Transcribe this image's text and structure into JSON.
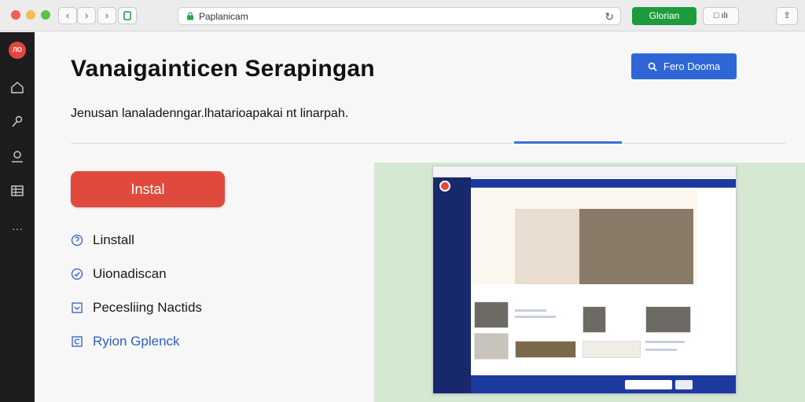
{
  "browser": {
    "url": "Paplanicam",
    "green_button_label": "Glorian",
    "reload_glyph": "↻",
    "back_glyph": "‹",
    "forward_glyph": "›",
    "ext_label": "□ ılı",
    "share_glyph": "⇪"
  },
  "rail": {
    "logo_text": "ЛО",
    "icons": [
      "home-icon",
      "tool-icon",
      "search-person-icon",
      "table-icon",
      "more-icon"
    ],
    "more_glyph": "···"
  },
  "main": {
    "title": "Vanaigainticen Serapingan",
    "subtitle": "Jenusan lanaladenngar.lhatarioapakai nt linarpah.",
    "cta_label": "Fero Dooma",
    "install_label": "Instal",
    "features": [
      {
        "label": "Linstall",
        "icon": "info-circle-icon"
      },
      {
        "label": "Uionadiscan",
        "icon": "check-circle-icon"
      },
      {
        "label": "Pecesliing Nactids",
        "icon": "download-box-icon"
      },
      {
        "label": "Ryion Gplenck",
        "icon": "refresh-box-icon"
      }
    ]
  },
  "colors": {
    "accent_blue": "#2f66d6",
    "install_red": "#e04a3d",
    "green": "#1f9b3d",
    "rail": "#1d1d1f",
    "preview_bg": "#d5e8d1"
  }
}
